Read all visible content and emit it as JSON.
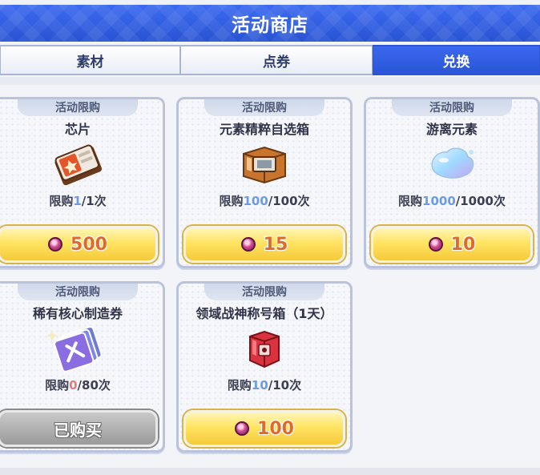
{
  "header": {
    "title": "活动商店"
  },
  "tabs": [
    {
      "label": "素材",
      "active": false
    },
    {
      "label": "点券",
      "active": false
    },
    {
      "label": "兑换",
      "active": true
    }
  ],
  "items": [
    {
      "tag": "活动限购",
      "name": "芯片",
      "icon": "chip-icon",
      "limit_prefix": "限购",
      "bought": "1",
      "total": "/1次",
      "price": "500",
      "status": "available"
    },
    {
      "tag": "活动限购",
      "name": "元素精粹自选箱",
      "icon": "element-box-icon",
      "limit_prefix": "限购",
      "bought": "100",
      "total": "/100次",
      "price": "15",
      "status": "available"
    },
    {
      "tag": "活动限购",
      "name": "游离元素",
      "icon": "slime-crystal-icon",
      "limit_prefix": "限购",
      "bought": "1000",
      "total": "/1000次",
      "price": "10",
      "status": "available"
    },
    {
      "tag": "活动限购",
      "name": "稀有核心制造券",
      "icon": "rare-core-ticket-icon",
      "limit_prefix": "限购",
      "bought": "0",
      "total": "/80次",
      "price": "",
      "status": "sold_out",
      "sold_label": "已购买"
    },
    {
      "tag": "活动限购",
      "name": "领域战神称号箱（1天）",
      "icon": "title-box-icon",
      "limit_prefix": "限购",
      "bought": "10",
      "total": "/10次",
      "price": "100",
      "status": "available"
    }
  ],
  "currency_icon": "pink-gem-icon",
  "colors": {
    "header_blue": "#2f5fe0",
    "button_yellow": "#ffe463",
    "price_orange": "#e06a2a",
    "limit_blue": "#6c9be6",
    "limit_red": "#e47a7a"
  }
}
